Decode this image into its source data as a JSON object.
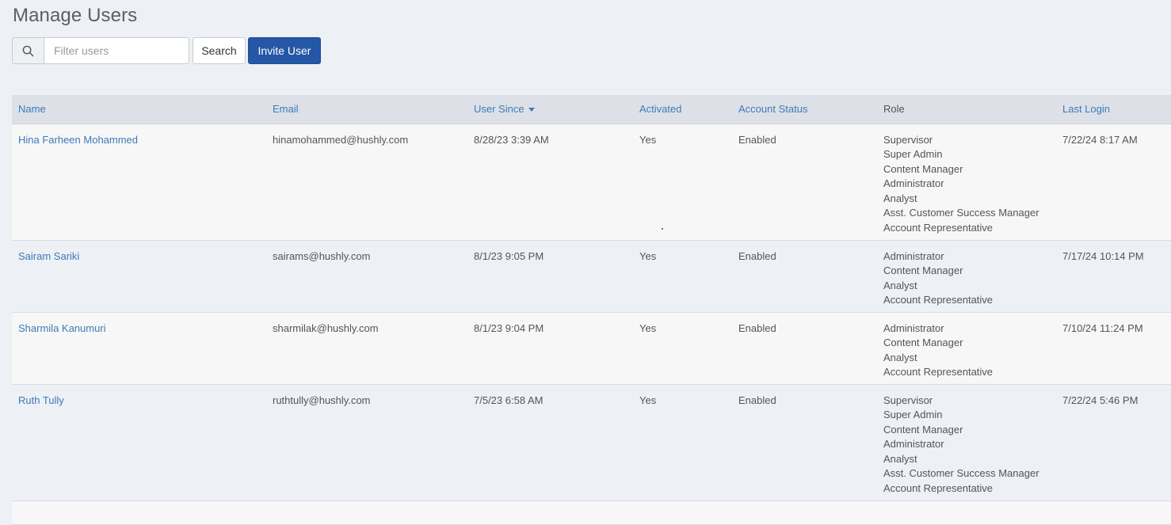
{
  "page": {
    "title": "Manage Users"
  },
  "toolbar": {
    "filter_placeholder": "Filter users",
    "filter_value": "",
    "search_label": "Search",
    "invite_label": "Invite User"
  },
  "icons": {
    "search": "search-icon",
    "sort": "caret-down-icon"
  },
  "colors": {
    "link": "#3d7ab8",
    "primary_button": "#2557a7",
    "page_bg": "#edf0f5"
  },
  "table": {
    "columns": [
      "Name",
      "Email",
      "User Since",
      "Activated",
      "Account Status",
      "Role",
      "Last Login"
    ],
    "sorted_by": "User Since",
    "rows": [
      {
        "name": "Hina Farheen Mohammed",
        "email": "hinamohammed@hushly.com",
        "user_since": "8/28/23 3:39 AM",
        "activated": "Yes",
        "status": "Enabled",
        "roles": [
          "Supervisor",
          "Super Admin",
          "Content Manager",
          "Administrator",
          "Analyst",
          "Asst. Customer Success Manager",
          "Account Representative"
        ],
        "last_login": "7/22/24 8:17 AM"
      },
      {
        "name": "Sairam Sariki",
        "email": "sairams@hushly.com",
        "user_since": "8/1/23 9:05 PM",
        "activated": "Yes",
        "status": "Enabled",
        "roles": [
          "Administrator",
          "Content Manager",
          "Analyst",
          "Account Representative"
        ],
        "last_login": "7/17/24 10:14 PM"
      },
      {
        "name": "Sharmila Kanumuri",
        "email": "sharmilak@hushly.com",
        "user_since": "8/1/23 9:04 PM",
        "activated": "Yes",
        "status": "Enabled",
        "roles": [
          "Administrator",
          "Content Manager",
          "Analyst",
          "Account Representative"
        ],
        "last_login": "7/10/24 11:24 PM"
      },
      {
        "name": "Ruth Tully",
        "email": "ruthtully@hushly.com",
        "user_since": "7/5/23 6:58 AM",
        "activated": "Yes",
        "status": "Enabled",
        "roles": [
          "Supervisor",
          "Super Admin",
          "Content Manager",
          "Administrator",
          "Analyst",
          "Asst. Customer Success Manager",
          "Account Representative"
        ],
        "last_login": "7/22/24 5:46 PM"
      }
    ]
  }
}
